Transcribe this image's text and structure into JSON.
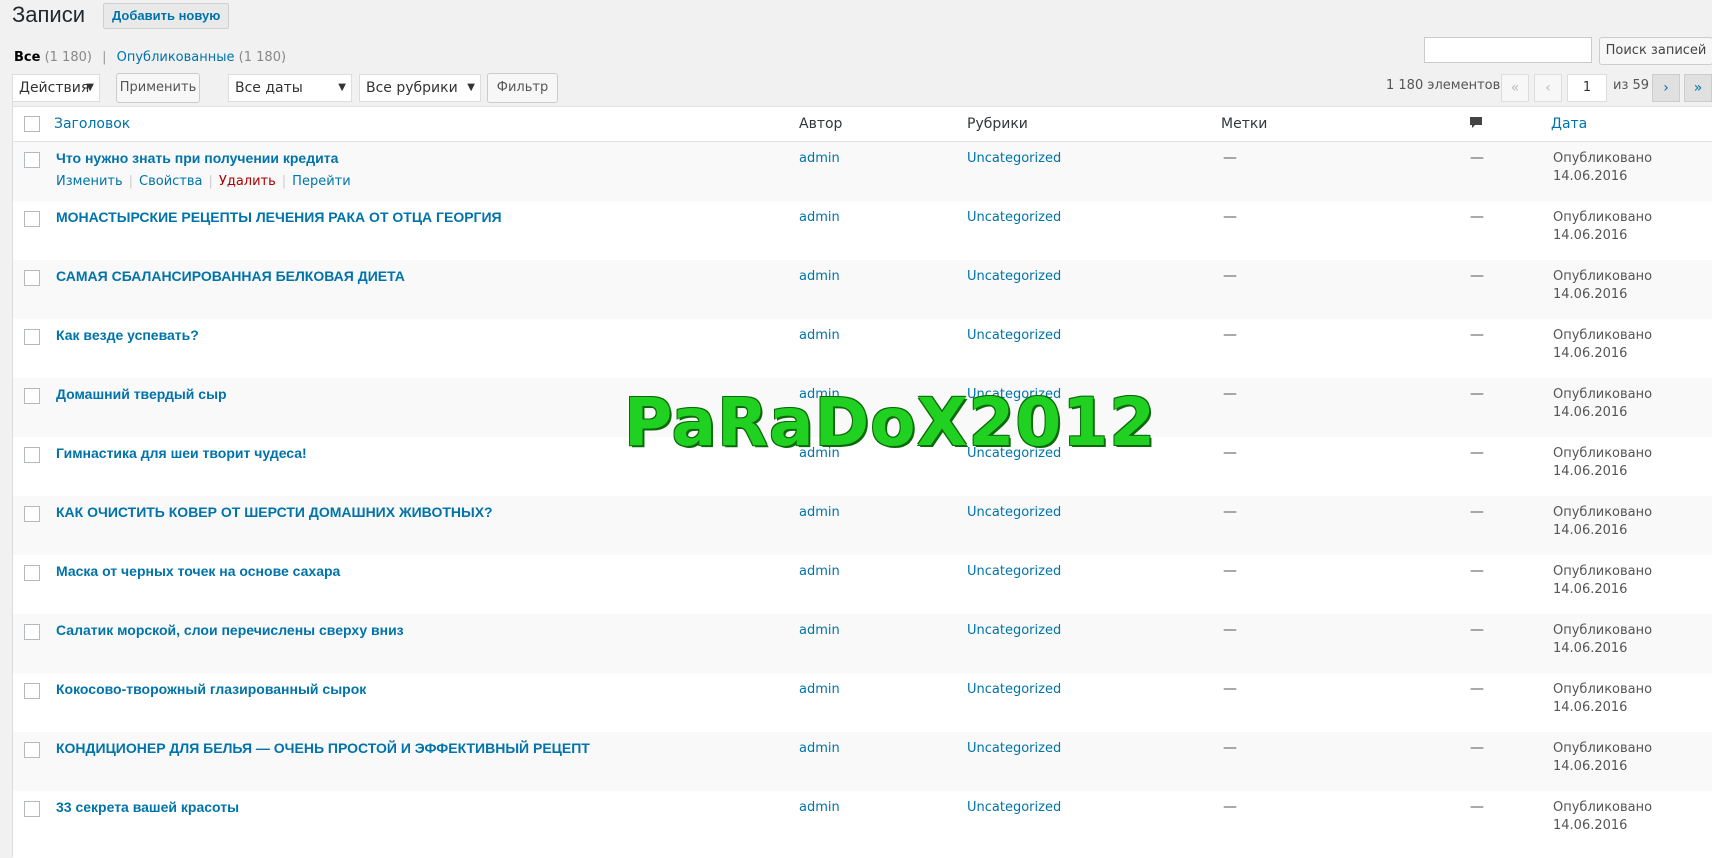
{
  "header": {
    "title": "Записи",
    "add_new_label": "Добавить новую"
  },
  "views": {
    "all_label": "Все",
    "all_count": "(1 180)",
    "separator": "|",
    "published_label": "Опубликованные",
    "published_count": "(1 180)"
  },
  "search": {
    "placeholder": "",
    "button_label": "Поиск записей"
  },
  "tablenav": {
    "bulk_action": "Действия",
    "apply_label": "Применить",
    "dates_filter": "Все даты",
    "categories_filter": "Все рубрики",
    "filter_label": "Фильтр",
    "items_count": "1 180 элементов",
    "first_page": "«",
    "prev_page": "‹",
    "current_page": "1",
    "of_pages": "из 59",
    "next_page": "›",
    "last_page": "»",
    "caret": "▼"
  },
  "columns": {
    "title": "Заголовок",
    "author": "Автор",
    "categories": "Рубрики",
    "tags": "Метки",
    "date": "Дата"
  },
  "row_actions": {
    "edit": "Изменить",
    "properties": "Свойства",
    "delete": "Удалить",
    "view": "Перейти",
    "pipe": "|"
  },
  "rows": [
    {
      "title": "Что нужно знать при получении кредита",
      "author": "admin",
      "category": "Uncategorized",
      "tags": "—",
      "comments": "—",
      "status": "Опубликовано",
      "date": "14.06.2016"
    },
    {
      "title": "МОНАСТЫРСКИЕ РЕЦЕПТЫ ЛЕЧЕНИЯ РАКА ОТ ОТЦА ГЕОРГИЯ",
      "author": "admin",
      "category": "Uncategorized",
      "tags": "—",
      "comments": "—",
      "status": "Опубликовано",
      "date": "14.06.2016"
    },
    {
      "title": "САМАЯ СБАЛАНСИРОВАННАЯ БЕЛКОВАЯ ДИЕТА",
      "author": "admin",
      "category": "Uncategorized",
      "tags": "—",
      "comments": "—",
      "status": "Опубликовано",
      "date": "14.06.2016"
    },
    {
      "title": "Как везде успевать?",
      "author": "admin",
      "category": "Uncategorized",
      "tags": "—",
      "comments": "—",
      "status": "Опубликовано",
      "date": "14.06.2016"
    },
    {
      "title": "Домашний твердый сыр",
      "author": "admin",
      "category": "Uncategorized",
      "tags": "—",
      "comments": "—",
      "status": "Опубликовано",
      "date": "14.06.2016"
    },
    {
      "title": "Гимнастика для шеи творит чудеса!",
      "author": "admin",
      "category": "Uncategorized",
      "tags": "—",
      "comments": "—",
      "status": "Опубликовано",
      "date": "14.06.2016"
    },
    {
      "title": "КАК ОЧИСТИТЬ КОВЕР ОТ ШЕРСТИ ДОМАШНИХ ЖИВОТНЫХ?",
      "author": "admin",
      "category": "Uncategorized",
      "tags": "—",
      "comments": "—",
      "status": "Опубликовано",
      "date": "14.06.2016"
    },
    {
      "title": "Маска от черных точек на основе сахара",
      "author": "admin",
      "category": "Uncategorized",
      "tags": "—",
      "comments": "—",
      "status": "Опубликовано",
      "date": "14.06.2016"
    },
    {
      "title": "Салатик морской, слои перечислены сверху вниз",
      "author": "admin",
      "category": "Uncategorized",
      "tags": "—",
      "comments": "—",
      "status": "Опубликовано",
      "date": "14.06.2016"
    },
    {
      "title": "Кокосово-творожный глазированный сырок",
      "author": "admin",
      "category": "Uncategorized",
      "tags": "—",
      "comments": "—",
      "status": "Опубликовано",
      "date": "14.06.2016"
    },
    {
      "title": "КОНДИЦИОНЕР ДЛЯ БЕЛЬЯ — ОЧЕНЬ ПРОСТОЙ И ЭФФЕКТИВНЫЙ РЕЦЕПТ",
      "author": "admin",
      "category": "Uncategorized",
      "tags": "—",
      "comments": "—",
      "status": "Опубликовано",
      "date": "14.06.2016"
    },
    {
      "title": "33 секрета вашей красоты",
      "author": "admin",
      "category": "Uncategorized",
      "tags": "—",
      "comments": "—",
      "status": "Опубликовано",
      "date": "14.06.2016"
    }
  ],
  "watermark": {
    "text": "PaRaDoX2012"
  },
  "colors": {
    "link": "#0073aa",
    "delete": "#aa0000",
    "watermark": "#21d121"
  }
}
